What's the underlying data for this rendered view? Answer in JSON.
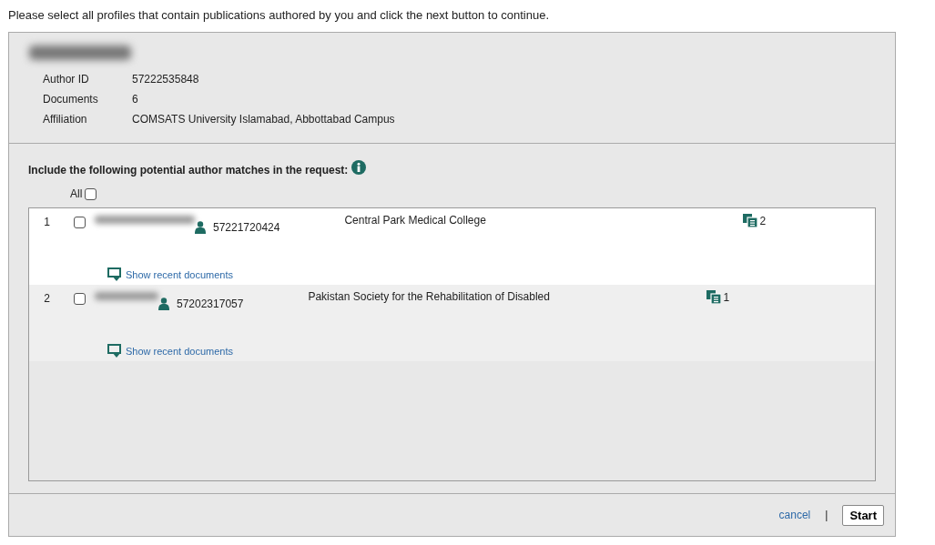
{
  "instruction": "Please select all profiles that contain publications authored by you and click the next button to continue.",
  "profile": {
    "fields": [
      {
        "label": "Author ID",
        "value": "57222535848"
      },
      {
        "label": "Documents",
        "value": "6"
      },
      {
        "label": "Affiliation",
        "value": "COMSATS University Islamabad, Abbottabad Campus"
      }
    ]
  },
  "matches": {
    "heading": "Include the following potential author matches in the request:",
    "all_label": "All",
    "all_checked": false,
    "rows": [
      {
        "index": "1",
        "checked": false,
        "author_id": "57221720424",
        "affiliation": "Central Park Medical College",
        "documents": "2",
        "link": "Show recent documents"
      },
      {
        "index": "2",
        "checked": false,
        "author_id": "57202317057",
        "affiliation": "Pakistan Society for the Rehabilitation of Disabled",
        "documents": "1",
        "link": "Show recent documents"
      }
    ]
  },
  "footer": {
    "cancel": "cancel",
    "separator": "|",
    "start": "Start"
  }
}
